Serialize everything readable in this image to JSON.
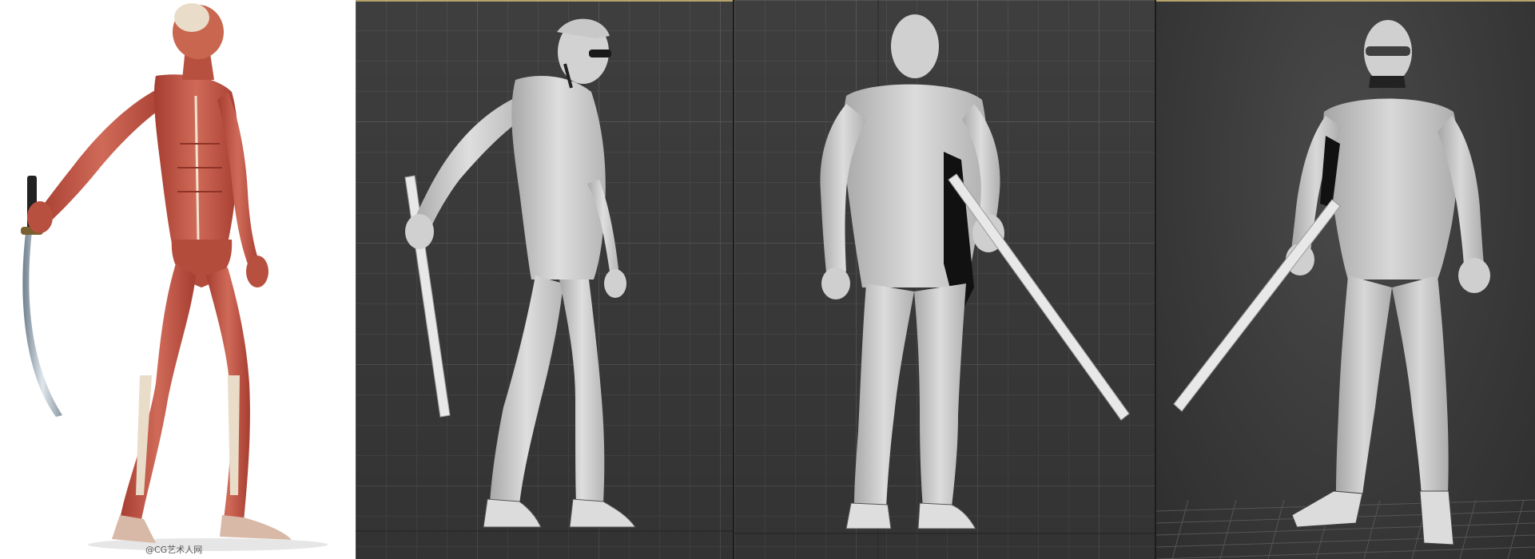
{
  "reference": {
    "watermark": "@CG艺术人网"
  },
  "viewports": [
    {
      "id": "side",
      "view": "left"
    },
    {
      "id": "back",
      "view": "back"
    },
    {
      "id": "persp",
      "view": "perspective"
    }
  ],
  "colors": {
    "muscle": "#c4594a",
    "muscle_dark": "#8e3328",
    "tendon": "#e9dcc8",
    "model": "#d2d2d2",
    "model_shadow": "#9a9a9a",
    "grid_bg": "#3e3e3e",
    "viewport_active_border": "#b4a36a"
  }
}
